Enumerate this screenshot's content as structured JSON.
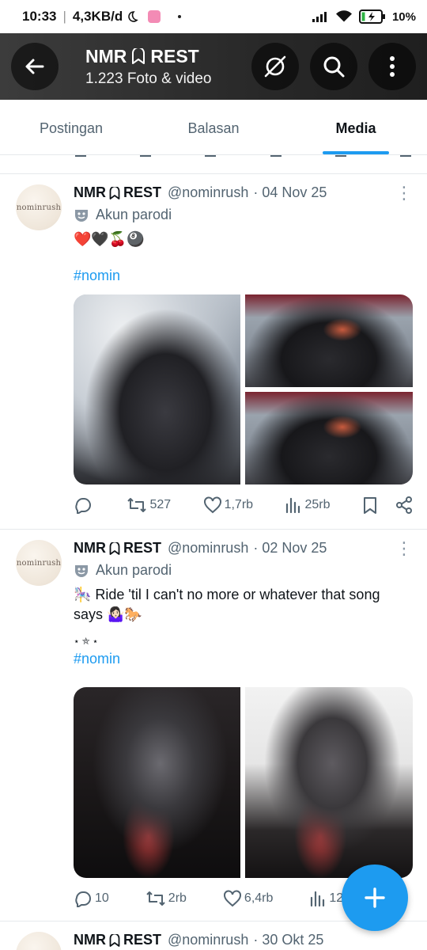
{
  "status_bar": {
    "time": "10:33",
    "network_speed": "4,3KB/d",
    "battery_percent": "10%",
    "icons": [
      "moon-icon",
      "gallery-icon",
      "signal-icon",
      "wifi-icon",
      "battery-charging-icon"
    ]
  },
  "header": {
    "title": "NMR",
    "title_suffix": "REST",
    "subtitle": "1.223 Foto & video",
    "icons": [
      "back-arrow-icon",
      "bookmark-outline-icon",
      "grok-icon",
      "search-icon",
      "more-vertical-icon"
    ]
  },
  "tabs": [
    {
      "label": "Postingan",
      "active": false
    },
    {
      "label": "Balasan",
      "active": false
    },
    {
      "label": "Media",
      "active": true
    }
  ],
  "tweets": [
    {
      "avatar_text": "nominrush",
      "name": "NMR",
      "name_suffix": "REST",
      "handle": "@nominrush",
      "date": "· 04 Nov 25",
      "label": "Akun parodi",
      "text": "❤️🖤🍒🎱",
      "hashtag": "#nomin",
      "replies": "",
      "reposts": "527",
      "likes": "1,7rb",
      "views": "25rb"
    },
    {
      "avatar_text": "nominrush",
      "name": "NMR",
      "name_suffix": "REST",
      "handle": "@nominrush",
      "date": "· 02 Nov 25",
      "label": "Akun parodi",
      "text_line1": "🎠 Ride 'til I can't no more or whatever that song",
      "text_line2": "says 🤷🏻‍♀️🐎",
      "sparkle": "⋆ ⛤ ⋆",
      "hashtag": "#nomin",
      "replies": "10",
      "reposts": "2rb",
      "likes": "6,4rb",
      "views": "122rb"
    },
    {
      "avatar_text": "nominrush",
      "name": "NMR",
      "name_suffix": "REST",
      "handle": "@nominrush",
      "date": "· 30 Okt 25"
    }
  ],
  "fab": {
    "icon": "plus-icon"
  },
  "colors": {
    "accent": "#1d9bf0",
    "text": "#0f1419",
    "muted": "#536471",
    "header_bg": "#2a2a2a"
  }
}
